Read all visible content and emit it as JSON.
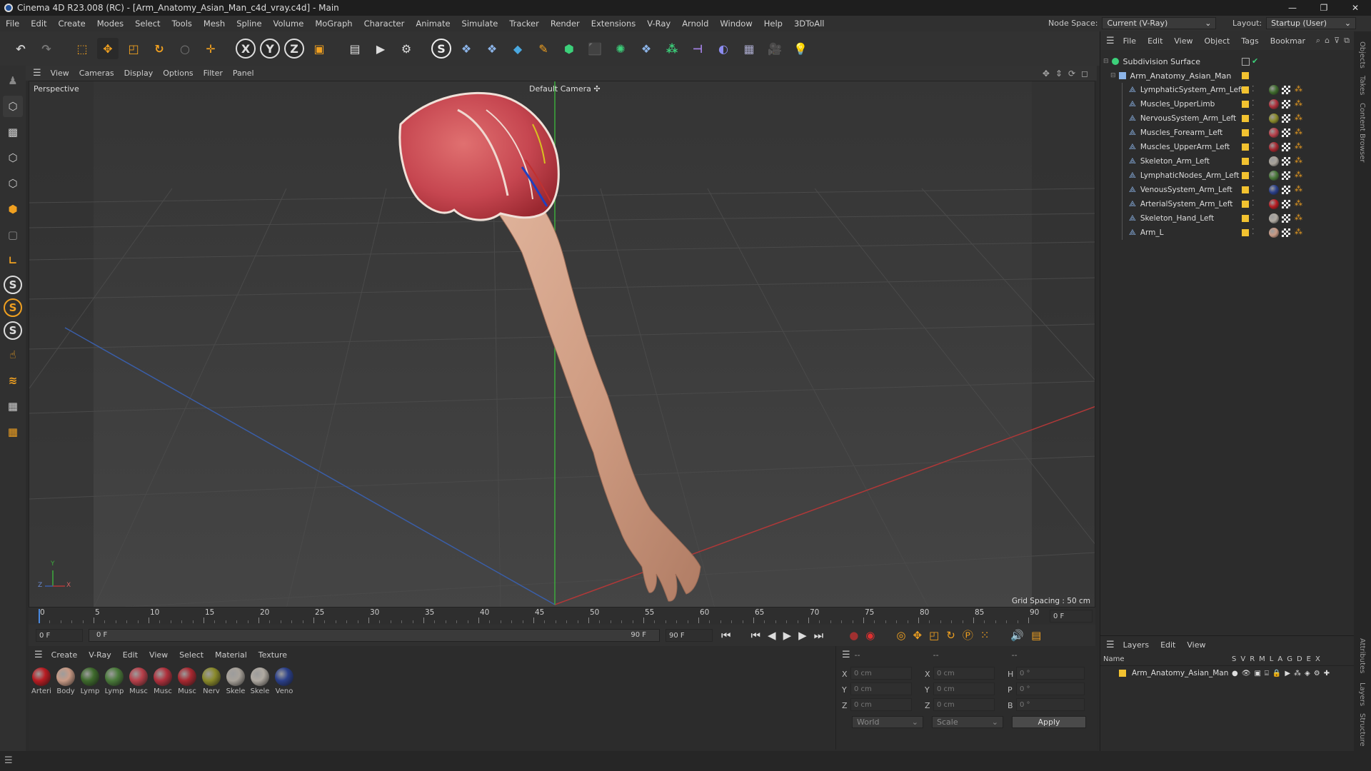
{
  "window": {
    "title": "Cinema 4D R23.008 (RC) - [Arm_Anatomy_Asian_Man_c4d_vray.c4d] - Main"
  },
  "menubar": {
    "items": [
      "File",
      "Edit",
      "Create",
      "Modes",
      "Select",
      "Tools",
      "Mesh",
      "Spline",
      "Volume",
      "MoGraph",
      "Character",
      "Animate",
      "Simulate",
      "Tracker",
      "Render",
      "Extensions",
      "V-Ray",
      "Arnold",
      "Window",
      "Help",
      "3DToAll"
    ],
    "node_space_label": "Node Space:",
    "node_space_value": "Current (V-Ray)",
    "layout_label": "Layout:",
    "layout_value": "Startup (User)"
  },
  "viewport": {
    "menu": [
      "View",
      "Cameras",
      "Display",
      "Options",
      "Filter",
      "Panel"
    ],
    "label": "Perspective",
    "camera": "Default Camera",
    "grid_spacing": "Grid Spacing : 50 cm",
    "axis_y": "Y",
    "axis_z": "Z",
    "axis_x": "X"
  },
  "timeline": {
    "ticks": [
      "0",
      "5",
      "10",
      "15",
      "20",
      "25",
      "30",
      "35",
      "40",
      "45",
      "50",
      "55",
      "60",
      "65",
      "70",
      "75",
      "80",
      "85",
      "90"
    ],
    "current_frame": "0 F",
    "start": "0 F",
    "range_start": "0 F",
    "range_end": "90 F",
    "end": "90 F"
  },
  "materials": {
    "menu": [
      "Create",
      "V-Ray",
      "Edit",
      "View",
      "Select",
      "Material",
      "Texture"
    ],
    "items": [
      {
        "label": "Arteri",
        "color": "#b81c22"
      },
      {
        "label": "Body",
        "color": "#c89a85"
      },
      {
        "label": "Lymp",
        "color": "#3e6a2c"
      },
      {
        "label": "Lymp",
        "color": "#4a7a3a"
      },
      {
        "label": "Musc",
        "color": "#b8404a"
      },
      {
        "label": "Musc",
        "color": "#b0303c"
      },
      {
        "label": "Musc",
        "color": "#a82830"
      },
      {
        "label": "Nerv",
        "color": "#8a8a2a"
      },
      {
        "label": "Skele",
        "color": "#a8a29a"
      },
      {
        "label": "Skele",
        "color": "#b0aaa2"
      },
      {
        "label": "Veno",
        "color": "#2a3f8a"
      }
    ]
  },
  "coords": {
    "header_left": "--",
    "header_mid": "--",
    "header_right": "--",
    "rows": [
      {
        "a": "X",
        "av": "0 cm",
        "b": "X",
        "bv": "0 cm",
        "c": "H",
        "cv": "0 °"
      },
      {
        "a": "Y",
        "av": "0 cm",
        "b": "Y",
        "bv": "0 cm",
        "c": "P",
        "cv": "0 °"
      },
      {
        "a": "Z",
        "av": "0 cm",
        "b": "Z",
        "bv": "0 cm",
        "c": "B",
        "cv": "0 °"
      }
    ],
    "world": "World",
    "scale": "Scale",
    "apply": "Apply"
  },
  "objects": {
    "menu": [
      "File",
      "Edit",
      "View",
      "Object",
      "Tags",
      "Bookmar"
    ],
    "root": "Subdivision Surface",
    "group": "Arm_Anatomy_Asian_Man",
    "children": [
      {
        "name": "LymphaticSystem_Arm_Left",
        "mat": "#3e6a2c"
      },
      {
        "name": "Muscles_UpperLimb",
        "mat": "#b0303c"
      },
      {
        "name": "NervousSystem_Arm_Left",
        "mat": "#8a8a2a"
      },
      {
        "name": "Muscles_Forearm_Left",
        "mat": "#b8404a"
      },
      {
        "name": "Muscles_UpperArm_Left",
        "mat": "#a82830"
      },
      {
        "name": "Skeleton_Arm_Left",
        "mat": "#a8a29a"
      },
      {
        "name": "LymphaticNodes_Arm_Left",
        "mat": "#4a7a3a"
      },
      {
        "name": "VenousSystem_Arm_Left",
        "mat": "#2a3f8a"
      },
      {
        "name": "ArterialSystem_Arm_Left",
        "mat": "#b81c22"
      },
      {
        "name": "Skeleton_Hand_Left",
        "mat": "#b0aaa2"
      },
      {
        "name": "Arm_L",
        "mat": "#c89a85"
      }
    ]
  },
  "layers": {
    "menu": [
      "Layers",
      "Edit",
      "View"
    ],
    "col_name": "Name",
    "cols": [
      "S",
      "V",
      "R",
      "M",
      "L",
      "A",
      "G",
      "D",
      "E",
      "X"
    ],
    "row": "Arm_Anatomy_Asian_Man"
  },
  "side_tabs": [
    "Objects",
    "Takes",
    "Content Browser",
    "Attributes",
    "Layers",
    "Structure"
  ],
  "colors": {
    "accent": "#f2c230",
    "ui_bg": "#2b2b2b"
  }
}
